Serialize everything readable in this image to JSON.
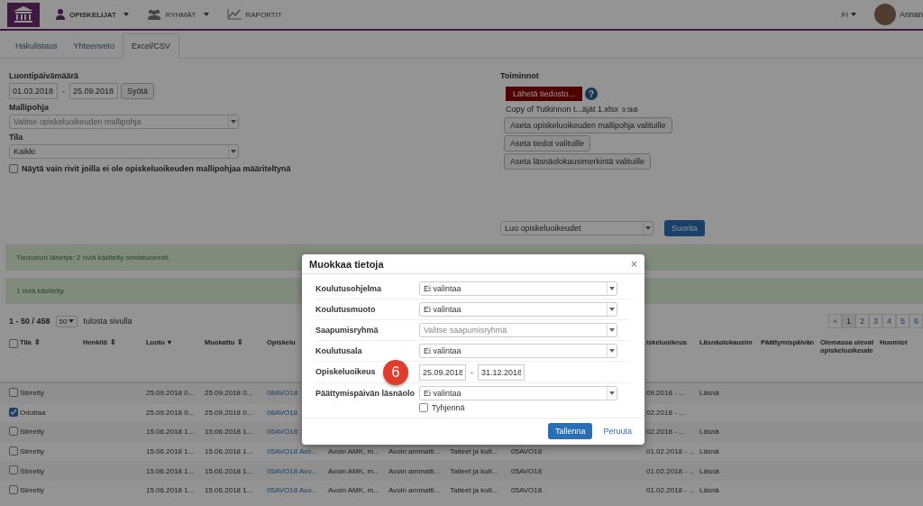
{
  "nav": {
    "menu": [
      {
        "label": "OPISKELIJAT",
        "caret": true,
        "selected": true
      },
      {
        "label": "RYHMÄT",
        "caret": true,
        "selected": false
      },
      {
        "label": "RAPORTIT",
        "caret": false,
        "selected": false
      }
    ],
    "language": "FI",
    "user": "Annan"
  },
  "tabs": [
    {
      "label": "Hakulistaus",
      "selected": false
    },
    {
      "label": "Yhteenveto",
      "selected": false
    },
    {
      "label": "Excel/CSV",
      "selected": true
    }
  ],
  "filters": {
    "date_label": "Luontipäivämäärä",
    "date_from": "01.03.2018",
    "date_sep": "-",
    "date_to": "25.09.2018",
    "apply": "Syötä",
    "template_label": "Mallipohja",
    "template_placeholder": "Valitse opiskeluoikeuden mallipohja",
    "state_label": "Tila",
    "state_value": "Kaikki",
    "only_without_template": {
      "label": "Näytä vain rivit joilla ei ole opiskeluoikeuden mallipohjaa määriteltynä",
      "checked": false
    }
  },
  "actions": {
    "title": "Toiminnot",
    "upload": "Lähetä tiedosto...",
    "help": "?",
    "file_name": "Copy of Tutkinnon t...äjät 1.xlsx",
    "file_size": "9.5kB",
    "buttons": [
      "Aseta opiskeluoikeuden mallipohja valituille",
      "Aseta tiedot valituille",
      "Aseta läsnäolokausimerkintä valituille"
    ],
    "operation": "Luo opiskeluoikeudet",
    "run": "Suorita"
  },
  "alerts": [
    "Tiedoston lähetys: 2 riviä käsitelty onnistuneesti.",
    "1 riviä käsitelty."
  ],
  "list": {
    "range": "1 - 50 / 458",
    "page_size": "50",
    "page_size_label": "tulosta sivulla",
    "pagination": [
      {
        "label": "«",
        "selected": false
      },
      {
        "label": "1",
        "selected": true
      },
      {
        "label": "2",
        "selected": false
      },
      {
        "label": "3",
        "selected": false
      },
      {
        "label": "4",
        "selected": false
      },
      {
        "label": "5",
        "selected": false
      },
      {
        "label": "6",
        "selected": false
      }
    ]
  },
  "table": {
    "select_all_checked": false,
    "columns": [
      {
        "label": "Tila",
        "sort_icon": "⇕"
      },
      {
        "label": "Henkilö",
        "sort_icon": "⇕"
      },
      {
        "label": "Luotu",
        "sort_icon": "▾"
      },
      {
        "label": "Muokattu",
        "sort_icon": "⇕"
      },
      {
        "label": "Opiskelu"
      },
      {},
      {},
      {},
      {},
      {
        "label": "iskeluoikeus"
      },
      {
        "label": "Läsnäolokausim"
      },
      {
        "label": "Päättymispäivän"
      },
      {
        "label": "Olemassa olevat opiskeluoikeude"
      },
      {
        "label": "Huomiot"
      }
    ],
    "rows": [
      {
        "checked": false,
        "cells": [
          "Siirretty",
          null,
          "25.09.2018 0...",
          "25.09.2018 0...",
          "08AVO18",
          null,
          null,
          null,
          null,
          "09.2018 - ...",
          "Läsnä",
          null,
          null,
          null
        ]
      },
      {
        "checked": true,
        "cells": [
          "Odottaa",
          null,
          "25.09.2018 0...",
          "25.09.2018 0...",
          "08AVO18",
          null,
          null,
          null,
          null,
          "02.2018 - ...",
          null,
          null,
          null,
          null
        ]
      },
      {
        "checked": false,
        "cells": [
          "Siirretty",
          null,
          "15.06.2018 1...",
          "15.06.2018 1...",
          "05AVO18",
          null,
          null,
          null,
          null,
          "02.2018 - ...",
          "Läsnä",
          null,
          null,
          null
        ]
      },
      {
        "checked": false,
        "cells": [
          "Siirretty",
          null,
          "15.06.2018 1...",
          "15.06.2018 1...",
          "05AVO18 Avo...",
          "Avoin AMK, m...",
          "Avoin ammatti...",
          "Taiteet ja kult...",
          "05AVO18",
          "01.02.2018 - ...",
          "Läsnä",
          null,
          null,
          null
        ]
      },
      {
        "checked": false,
        "cells": [
          "Siirretty",
          null,
          "15.06.2018 1...",
          "15.06.2018 1...",
          "05AVO18 Avo...",
          "Avoin AMK, m...",
          "Avoin ammatti...",
          "Taiteet ja kult...",
          "05AVO18",
          "01.02.2018 - ...",
          "Läsnä",
          null,
          null,
          null
        ]
      },
      {
        "checked": false,
        "cells": [
          "Siirretty",
          null,
          "15.06.2018 1...",
          "15.06.2018 1...",
          "05AVO18 Avo...",
          "Avoin AMK, m...",
          "Avoin ammatti...",
          "Taiteet ja kult...",
          "05AVO18",
          "01.02.2018 - ...",
          "Läsnä",
          null,
          null,
          null
        ]
      }
    ]
  },
  "modal": {
    "title": "Muokkaa tietoja",
    "close": "×",
    "badge": "6",
    "fields": [
      {
        "kind": "select",
        "label": "Koulutusohjelma",
        "value": "Ei valintaa"
      },
      {
        "kind": "select",
        "label": "Koulutusmuoto",
        "value": "Ei valintaa"
      },
      {
        "kind": "select",
        "label": "Saapumisryhmä",
        "placeholder": "Valitse saapumisryhmä"
      },
      {
        "kind": "select",
        "label": "Koulutusala",
        "value": "Ei valintaa"
      },
      {
        "kind": "daterange",
        "label": "Opiskeluoikeus",
        "from": "25.09.2018",
        "sep": "-",
        "to": "31.12.2018"
      },
      {
        "kind": "select",
        "label": "Päättymispäivän läsnäolo",
        "value": "Ei valintaa",
        "clear": {
          "label": "Tyhjennä",
          "checked": false
        }
      }
    ],
    "save": "Tallenna",
    "cancel": "Peruuta"
  }
}
